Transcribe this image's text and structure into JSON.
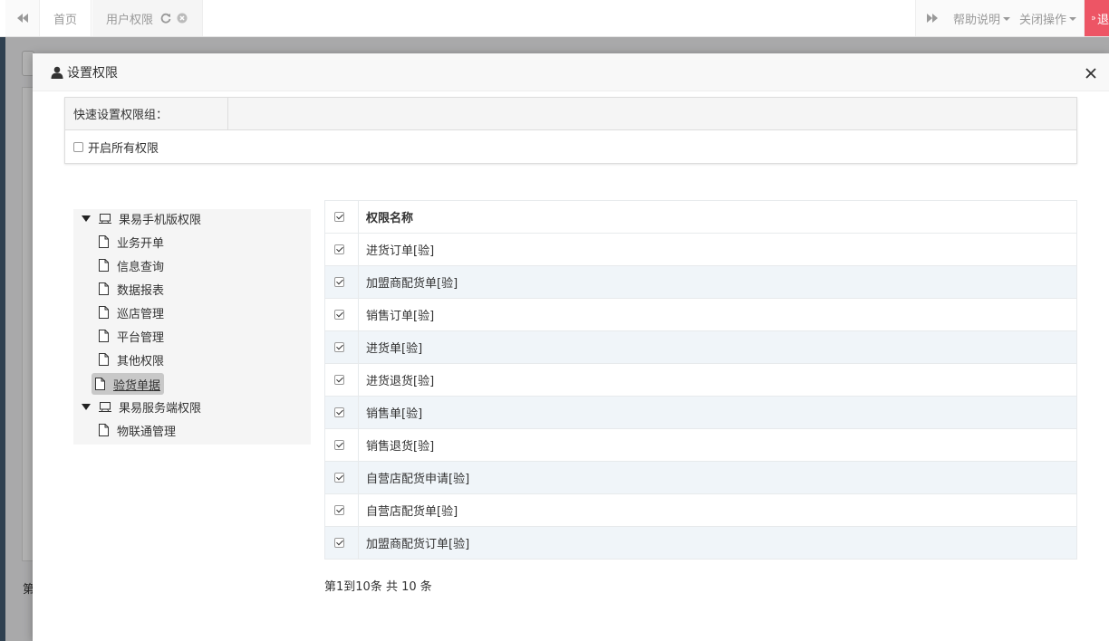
{
  "topbar": {
    "tabs": [
      {
        "label": "首页"
      },
      {
        "label": "用户权限"
      }
    ],
    "help_label": "帮助说明",
    "close_ops_label": "关闭操作",
    "logout_label": "退"
  },
  "background": {
    "footer_partial": "第"
  },
  "modal": {
    "title": "设置权限",
    "quick_group_label": "快速设置权限组：",
    "enable_all_label": "开启所有权限",
    "tree": {
      "groups": [
        {
          "label": "果易手机版权限",
          "children": [
            "业务开单",
            "信息查询",
            "数据报表",
            "巡店管理",
            "平台管理",
            "其他权限",
            "验货单据"
          ]
        },
        {
          "label": "果易服务端权限",
          "children": [
            "物联通管理"
          ]
        }
      ],
      "selected": "验货单据"
    },
    "table": {
      "header": "权限名称",
      "rows": [
        "进货订单[验]",
        "加盟商配货单[验]",
        "销售订单[验]",
        "进货单[验]",
        "进货退货[验]",
        "销售单[验]",
        "销售退货[验]",
        "自营店配货申请[验]",
        "自营店配货单[验]",
        "加盟商配货订单[验]"
      ]
    },
    "pager_text": "第1到10条 共 10 条"
  },
  "colors": {
    "logout_bg": "#ed5565",
    "row_stripe": "#f0f5f9",
    "sidebar": "#2f4050"
  }
}
